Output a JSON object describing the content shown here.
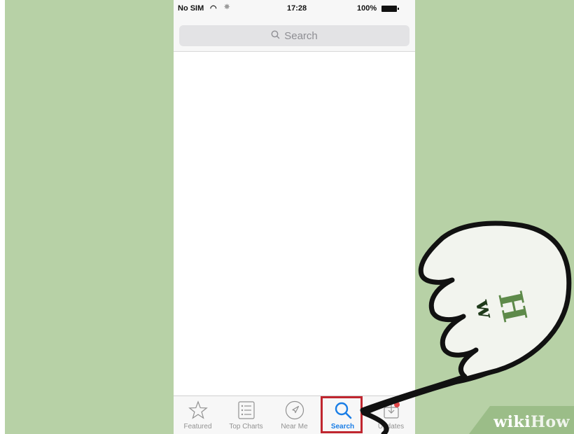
{
  "status_bar": {
    "carrier": "No SIM",
    "time": "17:28",
    "battery": "100%"
  },
  "search": {
    "placeholder": "Search"
  },
  "tabbar": {
    "tabs": [
      {
        "label": "Featured",
        "icon": "star-icon"
      },
      {
        "label": "Top Charts",
        "icon": "list-icon"
      },
      {
        "label": "Near Me",
        "icon": "location-arrow-icon"
      },
      {
        "label": "Search",
        "icon": "search-icon",
        "active": true
      },
      {
        "label": "Updates",
        "icon": "updates-icon"
      }
    ],
    "active_color": "#1a7ee6",
    "highlight_color": "#c0262f"
  },
  "watermark": {
    "part1": "wiki",
    "part2": "How"
  },
  "colors": {
    "background": "#b7d1a6"
  }
}
